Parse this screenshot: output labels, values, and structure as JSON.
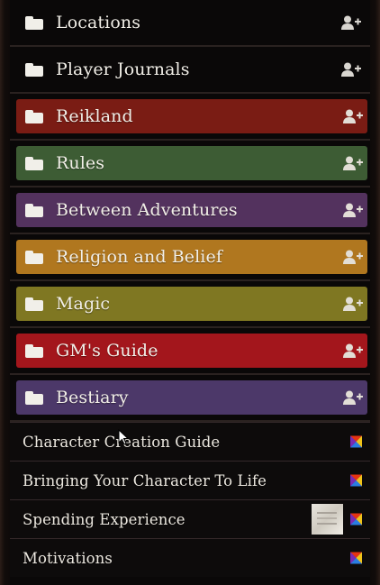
{
  "folders": [
    {
      "label": "Locations",
      "color": null
    },
    {
      "label": "Player Journals",
      "color": null
    },
    {
      "label": "Reikland",
      "color": "#7a1c14"
    },
    {
      "label": "Rules",
      "color": "#3d5c34"
    },
    {
      "label": "Between Adventures",
      "color": "#53325e"
    },
    {
      "label": "Religion and Belief",
      "color": "#b0771f"
    },
    {
      "label": "Magic",
      "color": "#7f7722"
    },
    {
      "label": "GM's Guide",
      "color": "#a3161c"
    },
    {
      "label": "Bestiary",
      "color": "#4c3869"
    }
  ],
  "entries": [
    {
      "label": "Character Creation Guide",
      "has_thumbnail": false
    },
    {
      "label": "Bringing Your Character To Life",
      "has_thumbnail": false
    },
    {
      "label": "Spending Experience",
      "has_thumbnail": true
    },
    {
      "label": "Motivations",
      "has_thumbnail": false
    }
  ],
  "icons": {
    "folder": "folder-icon",
    "add_user": "user-plus-icon",
    "journal_entry": "colored-squares-icon"
  }
}
